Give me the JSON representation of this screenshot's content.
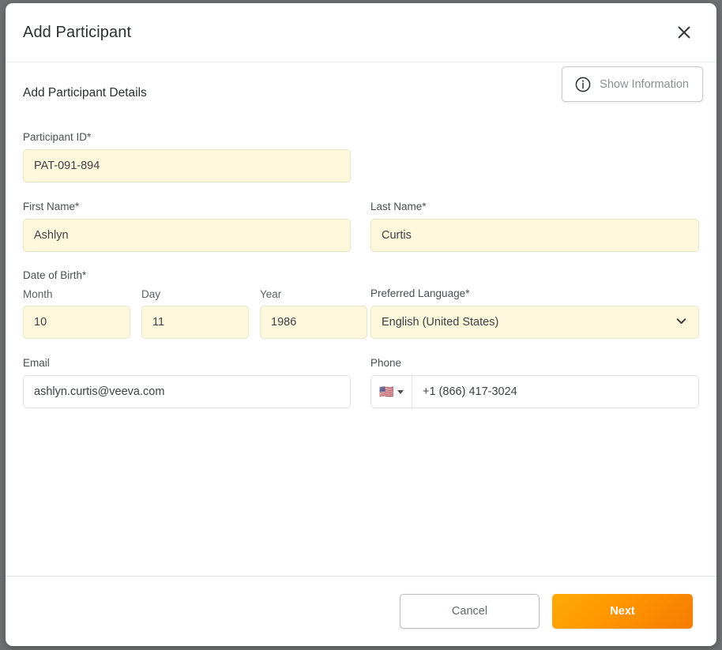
{
  "dialog": {
    "title": "Add Participant",
    "close_icon": "close-icon"
  },
  "body": {
    "section_title": "Add Participant Details",
    "info_button": {
      "label": "Show Information",
      "icon": "info-circle-icon"
    },
    "fields": {
      "participant_id": {
        "label": "Participant ID*",
        "value": "PAT-091-894"
      },
      "first_name": {
        "label": "First Name*",
        "value": "Ashlyn"
      },
      "last_name": {
        "label": "Last Name*",
        "value": "Curtis"
      },
      "date_of_birth": {
        "label": "Date of Birth*",
        "month": {
          "label": "Month",
          "value": "10"
        },
        "day": {
          "label": "Day",
          "value": "11"
        },
        "year": {
          "label": "Year",
          "value": "1986"
        }
      },
      "preferred_language": {
        "label": "Preferred Language*",
        "value": "English (United States)",
        "chevron_icon": "chevron-down-icon"
      },
      "email": {
        "label": "Email",
        "value": "ashlyn.curtis@veeva.com"
      },
      "phone": {
        "label": "Phone",
        "country_flag": "🇺🇸",
        "value": "+1 (866) 417-3024",
        "caret_icon": "caret-down-icon"
      }
    }
  },
  "footer": {
    "cancel_label": "Cancel",
    "next_label": "Next"
  },
  "colors": {
    "required_field_bg": "#FDF7DC",
    "required_field_border": "#E9E4C6",
    "primary_button_from": "#FFAB09",
    "primary_button_to": "#F57C00",
    "backdrop": "#6E7072",
    "text_primary": "#2B2F33",
    "text_muted": "#8A8F94"
  }
}
